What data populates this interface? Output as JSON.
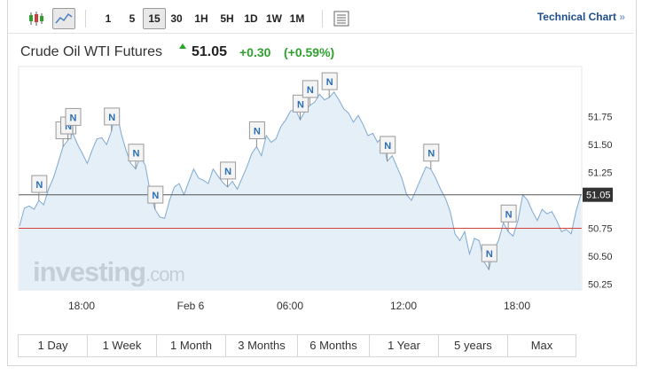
{
  "toolbar": {
    "chart_type_icons": [
      "candlestick-icon",
      "line-chart-icon"
    ],
    "intervals": [
      "1",
      "5",
      "15",
      "30",
      "1H",
      "5H",
      "1D",
      "1W",
      "1M"
    ],
    "active_interval": "15",
    "settings_icon": "table-icon",
    "technical_chart_label": "Technical Chart",
    "technical_chart_arrow": "»"
  },
  "header": {
    "instrument": "Crude Oil WTI Futures",
    "price": "51.05",
    "change": "+0.30",
    "change_pct": "(+0.59%)",
    "up_color": "#2ea02e"
  },
  "watermark": {
    "brand": "investing",
    "suffix": ".com"
  },
  "ranges": [
    "1 Day",
    "1 Week",
    "1 Month",
    "3 Months",
    "6 Months",
    "1 Year",
    "5 years",
    "Max"
  ],
  "chart_data": {
    "type": "area",
    "x_tick_labels": [
      "18:00",
      "Feb 6",
      "06:00",
      "12:00",
      "18:00"
    ],
    "y_tick_labels": [
      "51.75",
      "51.50",
      "51.25",
      "50.75",
      "50.50",
      "50.25"
    ],
    "ylim": [
      50.25,
      51.97
    ],
    "current_price_label": "51.05",
    "current_line": 51.05,
    "previous_close_line": 50.75,
    "series": [
      {
        "values": [
          50.77,
          50.93,
          50.95,
          50.92,
          51.0,
          50.96,
          51.1,
          51.2,
          51.34,
          51.48,
          51.54,
          51.6,
          51.5,
          51.42,
          51.33,
          51.45,
          51.55,
          51.56,
          51.5,
          51.62,
          51.82,
          51.6,
          51.45,
          51.33,
          51.28,
          51.4,
          51.31,
          51.08,
          50.92,
          50.85,
          50.84,
          51.0,
          51.12,
          51.15,
          51.05,
          51.17,
          51.28,
          51.2,
          51.18,
          51.15,
          51.28,
          51.22,
          51.16,
          51.12,
          51.17,
          51.1,
          51.2,
          51.3,
          51.42,
          51.48,
          51.4,
          51.58,
          51.52,
          51.55,
          51.66,
          51.72,
          51.8,
          51.82,
          51.72,
          51.8,
          51.85,
          51.88,
          51.95,
          51.9,
          51.92,
          51.97,
          51.9,
          51.82,
          51.78,
          51.7,
          51.76,
          51.68,
          51.58,
          51.6,
          51.52,
          51.57,
          51.35,
          51.4,
          51.3,
          51.2,
          51.05,
          51.0,
          51.1,
          51.2,
          51.3,
          51.28,
          51.2,
          51.1,
          51.02,
          50.9,
          50.7,
          50.64,
          50.72,
          50.52,
          50.66,
          50.64,
          50.45,
          50.38,
          50.56,
          50.64,
          50.8,
          50.72,
          50.68,
          50.82,
          51.05,
          51.0,
          50.9,
          50.82,
          50.92,
          50.88,
          50.9,
          50.82,
          50.72,
          50.74,
          50.7,
          50.9,
          51.05
        ]
      }
    ],
    "news_markers": [
      "N",
      "N",
      "N",
      "N",
      "N",
      "N",
      "N",
      "N",
      "N",
      "N",
      "N",
      "N",
      "N",
      "N",
      "N",
      "N"
    ]
  }
}
